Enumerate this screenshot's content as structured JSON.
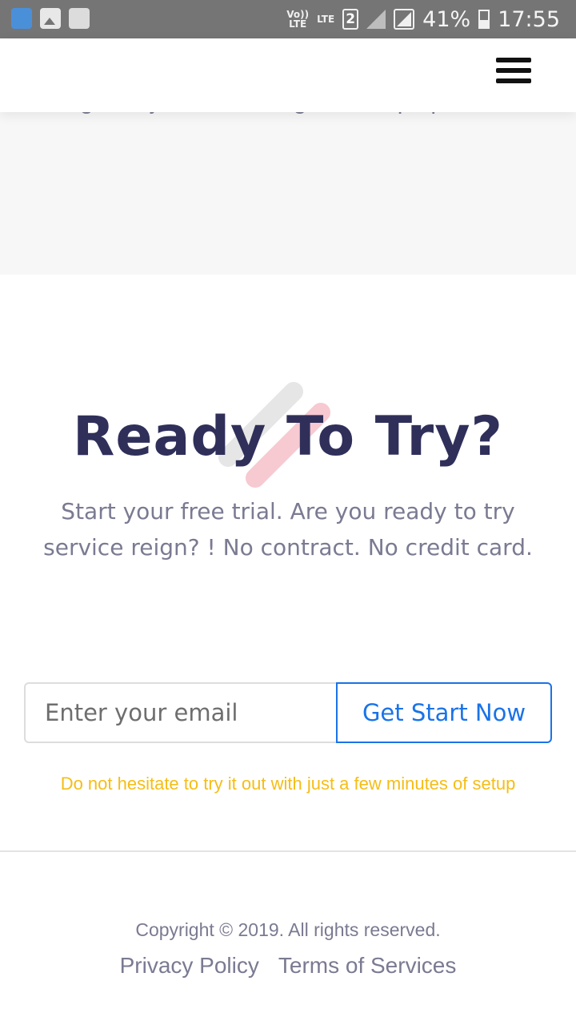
{
  "status_bar": {
    "icons": [
      "es-file-explorer-icon",
      "gallery-icon",
      "recycle-icon"
    ],
    "volte": "Vo))\nLTE",
    "lte": "LTE",
    "sim": "2",
    "battery_percent": "41%",
    "time": "17:55"
  },
  "header": {
    "menu_icon": "hamburger-menu-icon"
  },
  "features": {
    "text": "Images in just a few drag-and-drop operations."
  },
  "cta": {
    "title": "Ready To Try?",
    "description": "Start your free trial. Are you ready to try service reign? ! No contract. No credit card.",
    "email_placeholder": "Enter your email",
    "button_label": "Get Start Now",
    "hint": "Do not hesitate to try it out with just a few minutes of setup"
  },
  "footer": {
    "copyright": "Copyright © 2019. All rights reserved.",
    "links": [
      "Privacy Policy",
      "Terms of Services"
    ]
  },
  "colors": {
    "title": "#2f2f5a",
    "body_text": "#7a7a92",
    "accent_blue": "#1a73e8",
    "hint_yellow": "#f5bd16",
    "band_gray": "#f7f7f7"
  }
}
